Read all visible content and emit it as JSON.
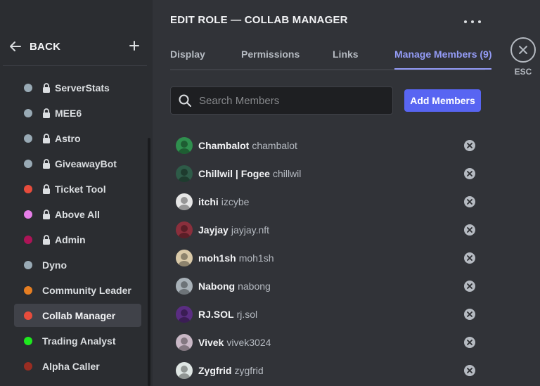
{
  "sidebar": {
    "back_label": "BACK",
    "roles": [
      {
        "name": "ServerStats",
        "color": "#99aab5",
        "locked": true
      },
      {
        "name": "MEE6",
        "color": "#99aab5",
        "locked": true
      },
      {
        "name": "Astro",
        "color": "#99aab5",
        "locked": true
      },
      {
        "name": "GiveawayBot",
        "color": "#99aab5",
        "locked": true
      },
      {
        "name": "Ticket Tool",
        "color": "#e74c3c",
        "locked": true
      },
      {
        "name": "Above All",
        "color": "#e67ee8",
        "locked": true
      },
      {
        "name": "Admin",
        "color": "#ad1457",
        "locked": true
      },
      {
        "name": "Dyno",
        "color": "#99aab5",
        "locked": false
      },
      {
        "name": "Community Leader",
        "color": "#e67e22",
        "locked": false
      },
      {
        "name": "Collab Manager",
        "color": "#e74c3c",
        "locked": false,
        "selected": true
      },
      {
        "name": "Trading Analyst",
        "color": "#1ee81e",
        "locked": false
      },
      {
        "name": "Alpha Caller",
        "color": "#992d22",
        "locked": false
      }
    ]
  },
  "header": {
    "title": "EDIT ROLE — COLLAB MANAGER",
    "tabs": [
      {
        "label": "Display"
      },
      {
        "label": "Permissions"
      },
      {
        "label": "Links"
      },
      {
        "label": "Manage Members (9)",
        "active": true
      }
    ],
    "esc_label": "ESC"
  },
  "search": {
    "placeholder": "Search Members",
    "value": ""
  },
  "add_members_label": "Add Members",
  "members": [
    {
      "display": "Chambalot",
      "username": "chambalot",
      "avatar_color": "#2f8f4e"
    },
    {
      "display": "Chillwil | Fogee",
      "username": "chillwil",
      "avatar_color": "#2e5b48"
    },
    {
      "display": "itchi",
      "username": "izcybe",
      "avatar_color": "#e6e6e6"
    },
    {
      "display": "Jayjay",
      "username": "jayjay.nft",
      "avatar_color": "#8a2f3c"
    },
    {
      "display": "moh1sh",
      "username": "moh1sh",
      "avatar_color": "#d9c9a8"
    },
    {
      "display": "Nabong",
      "username": "nabong",
      "avatar_color": "#a8b1b8"
    },
    {
      "display": "RJ.SOL",
      "username": "rj.sol",
      "avatar_color": "#5a2d82"
    },
    {
      "display": "Vivek",
      "username": "vivek3024",
      "avatar_color": "#c9b8c6"
    },
    {
      "display": "Zygfrid",
      "username": "zygfrid",
      "avatar_color": "#dfe6e4"
    }
  ],
  "colors": {
    "accent": "#5865f2",
    "tab_active": "#949cf7",
    "background": "#313338",
    "sidebar": "#2b2d31"
  }
}
